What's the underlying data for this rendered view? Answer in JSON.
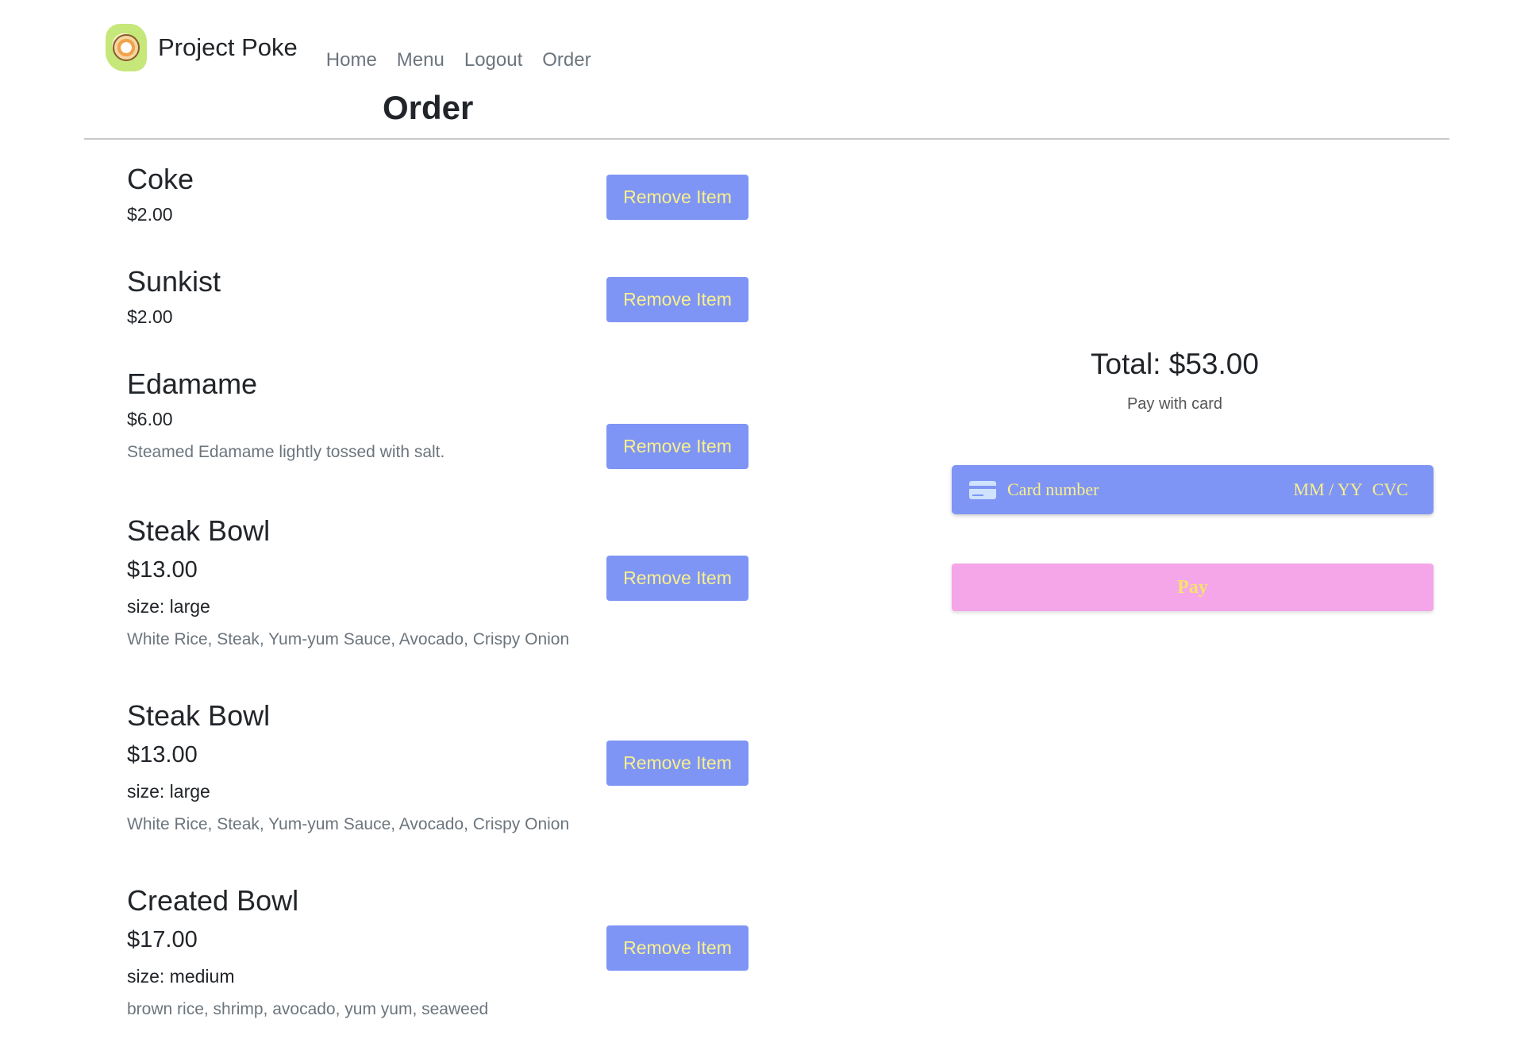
{
  "brand": {
    "name": "Project Poke",
    "logo_icon": "poke-bowl-logo-icon"
  },
  "nav": {
    "links": [
      "Home",
      "Menu",
      "Logout",
      "Order"
    ]
  },
  "page": {
    "title": "Order"
  },
  "items": [
    {
      "name": "Coke",
      "price": "$2.00",
      "remove_label": "Remove Item"
    },
    {
      "name": "Sunkist",
      "price": "$2.00",
      "remove_label": "Remove Item"
    },
    {
      "name": "Edamame",
      "price": "$6.00",
      "description": "Steamed Edamame lightly tossed with salt.",
      "remove_label": "Remove Item"
    },
    {
      "name": "Steak Bowl",
      "price": "$13.00",
      "size": "size: large",
      "description": "White Rice, Steak, Yum-yum Sauce, Avocado, Crispy Onion",
      "remove_label": "Remove Item"
    },
    {
      "name": "Steak Bowl",
      "price": "$13.00",
      "size": "size: large",
      "description": "White Rice, Steak, Yum-yum Sauce, Avocado, Crispy Onion",
      "remove_label": "Remove Item"
    },
    {
      "name": "Created Bowl",
      "price": "$17.00",
      "size": "size: medium",
      "description": "brown rice, shrimp, avocado, yum yum, seaweed",
      "remove_label": "Remove Item"
    }
  ],
  "payment": {
    "total": "Total: $53.00",
    "pay_with": "Pay with card",
    "card_number_placeholder": "Card number",
    "expiry_placeholder": "MM / YY",
    "cvc_placeholder": "CVC",
    "pay_label": "Pay",
    "card_icon": "credit-card-icon"
  },
  "colors": {
    "button_bg": "#7f95f5",
    "button_text": "#f9f08a",
    "pay_bg": "#f4a6e8",
    "pay_text": "#f6e26e"
  }
}
